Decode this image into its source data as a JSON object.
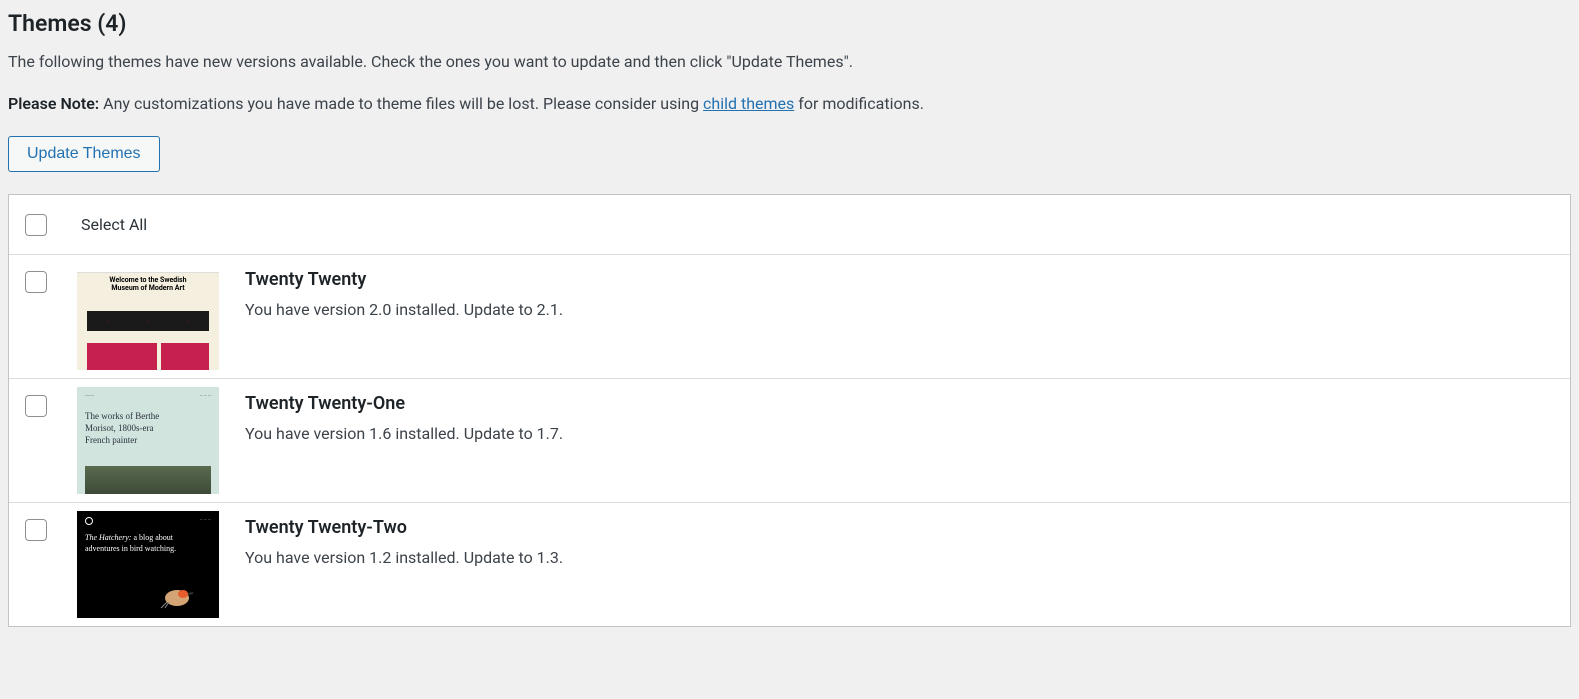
{
  "heading": {
    "label": "Themes",
    "count": "(4)"
  },
  "intro_text": "The following themes have new versions available. Check the ones you want to update and then click \"Update Themes\".",
  "note": {
    "prefix": "Please Note:",
    "body_before_link": " Any customizations you have made to theme files will be lost. Please consider using ",
    "link_text": "child themes",
    "body_after_link": " for modifications."
  },
  "update_button_label": "Update Themes",
  "select_all_label": "Select All",
  "themes": [
    {
      "name": "Twenty Twenty",
      "version_text": "You have version 2.0 installed. Update to 2.1.",
      "thumb": {
        "title_line1": "Welcome to the Swedish",
        "title_line2": "Museum of Modern Art"
      }
    },
    {
      "name": "Twenty Twenty-One",
      "version_text": "You have version 1.6 installed. Update to 1.7.",
      "thumb": {
        "headline": "The works of Berthe Morisot, 1800s-era French painter"
      }
    },
    {
      "name": "Twenty Twenty-Two",
      "version_text": "You have version 1.2 installed. Update to 1.3.",
      "thumb": {
        "headline_italic": "The Hatchery:",
        "headline_reg": " a blog about adventures in bird watching."
      }
    }
  ]
}
